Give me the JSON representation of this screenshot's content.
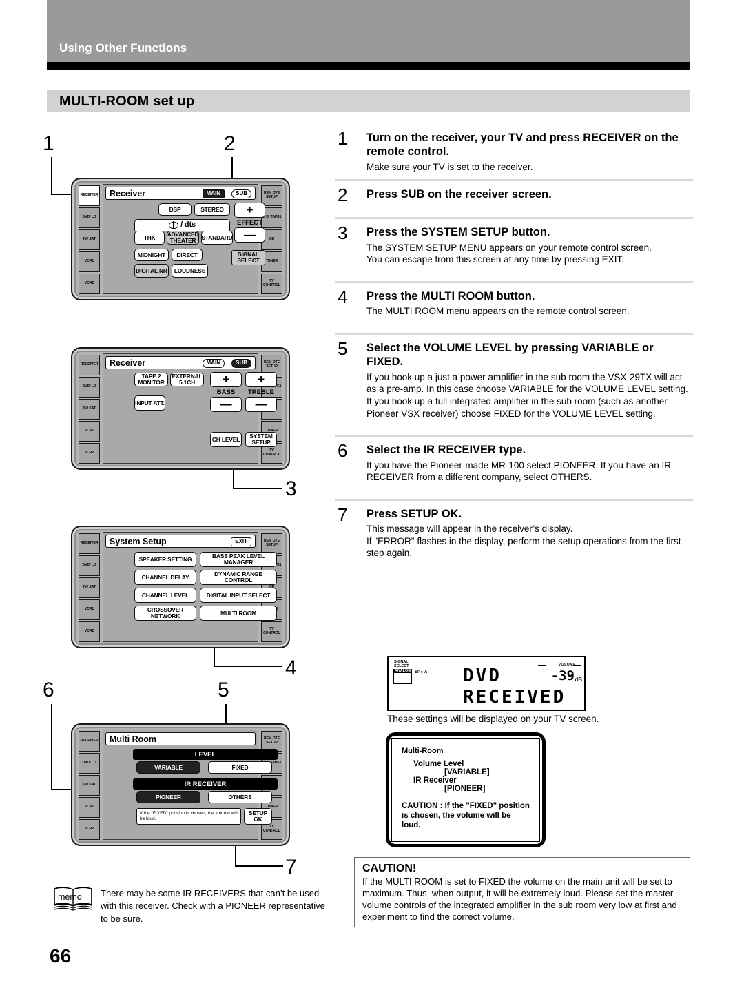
{
  "header": {
    "running_head": "Using Other Functions",
    "section_title": "MULTI-ROOM set up"
  },
  "page_number": "66",
  "callouts": [
    "1",
    "2",
    "3",
    "4",
    "5",
    "6",
    "7"
  ],
  "remotes": [
    {
      "name": "receiver-screen-1",
      "title": "Receiver",
      "pills": [
        {
          "label": "MAIN",
          "state": "on"
        },
        {
          "label": "SUB",
          "state": "off"
        }
      ],
      "side_left": [
        "RECEIVER",
        "DVD/ LD",
        "TV/ SAT",
        "VCR1",
        "VCR2"
      ],
      "side_right": [
        "REM OTE SETUP",
        "M D/ TAPE1",
        "CD",
        "TUNER",
        "TV CONTROL"
      ],
      "buttons": [
        "DSP",
        "STEREO",
        "+",
        "EFFECT",
        "—",
        "THX",
        "ADVANCED THEATER",
        "STANDARD",
        "MIDNIGHT",
        "DIRECT",
        "SIGNAL SELECT",
        "DIGITAL NR",
        "LOUDNESS"
      ],
      "format_label": "/ dts"
    },
    {
      "name": "receiver-screen-2",
      "title": "Receiver",
      "pills": [
        {
          "label": "MAIN",
          "state": "off"
        },
        {
          "label": "SUB",
          "state": "on"
        }
      ],
      "side_left": [
        "RECEIVER",
        "DVD/ LD",
        "TV/ SAT",
        "VCR1",
        "VCR2"
      ],
      "side_right": [
        "REM OTE SETUP",
        "M D/ TAPE1",
        "CD",
        "TUNER",
        "TV CONTROL"
      ],
      "buttons": [
        "TAPE 2 MONITOR",
        "EXTERNAL 5.1CH",
        "+",
        "+",
        "BASS",
        "TREBLE",
        "INPUT ATT.",
        "—",
        "—",
        "CH LEVEL",
        "SYSTEM SETUP"
      ]
    },
    {
      "name": "system-setup-screen",
      "title": "System Setup",
      "exit_label": "EXIT",
      "side_left": [
        "RECEIVER",
        "DVD/ LD",
        "TV/ SAT",
        "VCR1",
        "VCR2"
      ],
      "side_right": [
        "REM OTE SETUP",
        "M D/ TAPE1",
        "CD",
        "TUNER",
        "TV CONTROL"
      ],
      "menu": [
        "SPEAKER SETTING",
        "BASS PEAK LEVEL MANAGER",
        "CHANNEL DELAY",
        "DYNAMIC RANGE CONTROL",
        "CHANNEL LEVEL",
        "DIGITAL INPUT SELECT",
        "CROSSOVER NETWORK",
        "MULTI ROOM"
      ]
    },
    {
      "name": "multi-room-screen",
      "title": "Multi Room",
      "side_left": [
        "RECEIVER",
        "DVD/ LD",
        "TV/ SAT",
        "VCR1",
        "VCR2"
      ],
      "side_right": [
        "REM OTE SETUP",
        "M D/ TAPE1",
        "CD",
        "TUNER",
        "TV CONTROL"
      ],
      "group_level": "LEVEL",
      "level_options": [
        {
          "label": "VARIABLE",
          "selected": true
        },
        {
          "label": "FIXED",
          "selected": false
        }
      ],
      "group_ir": "IR RECEIVER",
      "ir_options": [
        {
          "label": "PIONEER",
          "selected": true
        },
        {
          "label": "OTHERS",
          "selected": false
        }
      ],
      "warning": "If the \"FIXED\" potision is chosen, the volume will be loud.",
      "setup_ok": "SETUP OK"
    }
  ],
  "steps": [
    {
      "num": "1",
      "head": "Turn on the receiver, your TV and press RECEIVER on the remote control.",
      "body": "Make sure your TV is set to the receiver."
    },
    {
      "num": "2",
      "head": "Press SUB on the receiver screen.",
      "body": ""
    },
    {
      "num": "3",
      "head": "Press the SYSTEM SETUP  button.",
      "body": "The SYSTEM SETUP MENU appears on your remote control screen.\nYou can escape from this screen at any time by pressing EXIT."
    },
    {
      "num": "4",
      "head": "Press the MULTI ROOM button.",
      "body": "The MULTI ROOM menu appears on the remote control screen."
    },
    {
      "num": "5",
      "head": "Select the VOLUME LEVEL by pressing VARIABLE or FIXED.",
      "body": "If you hook up a just a power amplifier in the sub room the VSX-29TX  will act as a pre-amp. In this case choose VARIABLE for the VOLUME LEVEL setting. If you hook up a full integrated amplifier in the sub room (such as another Pioneer VSX receiver) choose FIXED for the VOLUME LEVEL setting."
    },
    {
      "num": "6",
      "head": "Select the IR RECEIVER type.",
      "body": "If you have the Pioneer-made MR-100 select PIONEER. If you have an IR RECEIVER from a different company, select OTHERS."
    },
    {
      "num": "7",
      "head": "Press SETUP OK.",
      "body": "This message will appear in the receiver’s display.\nIf \"ERROR\" flashes in the display, perform the setup operations from the first step again."
    }
  ],
  "display": {
    "signal_select": "SIGNAL SELECT",
    "analog": "ANALOG",
    "speaker": "SP ▸ A",
    "line1": "DVD",
    "line2": "RECEIVED",
    "volume_label": "VOLUME",
    "volume_value": "-39",
    "volume_unit": "dB"
  },
  "display_caption": "These settings will be displayed on your TV screen.",
  "tv_screen": {
    "title": "Multi-Room",
    "row1_label": "Volume Level",
    "row1_value": "[VARIABLE]",
    "row2_label": "IR Receiver",
    "row2_value": "[PIONEER]",
    "caution": "CAUTION : If the \"FIXED\" position  is chosen, the volume will be loud."
  },
  "caution_box": {
    "title": "CAUTION!",
    "body": "If the MULTI ROOM is set to FIXED the volume on the main unit will be set to maximum. Thus, when output, it will be extremely loud. Please set the master volume controls of the integrated amplifier in the sub room very low at first and experiment to find the correct volume."
  },
  "memo": {
    "label": "memo",
    "text": "There may be some IR RECEIVERS that can’t be used with this receiver. Check with a PIONEER representative to be sure."
  }
}
